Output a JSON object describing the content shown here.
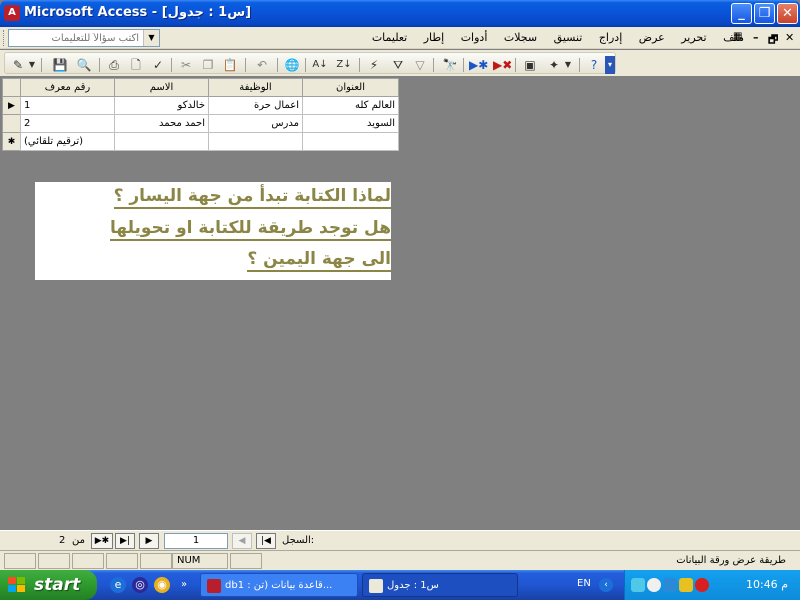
{
  "window": {
    "title": "Microsoft Access - [س1 : جدول]",
    "app_icon": "A",
    "controls": {
      "minimize": "_",
      "restore": "❐",
      "close": "✕"
    }
  },
  "help_box": {
    "placeholder": "اكتب سؤالاً للتعليمات"
  },
  "menu": {
    "items": [
      "ملف",
      "تحرير",
      "عرض",
      "إدراج",
      "تنسيق",
      "سجلات",
      "أدوات",
      "إطار",
      "تعليمات"
    ],
    "doc_controls": {
      "restore": "🗗",
      "minimize": "–",
      "close": "✕"
    }
  },
  "toolbar": {
    "icons": [
      "design-view-icon",
      "save-icon",
      "search-icon",
      "print-icon",
      "print-preview-icon",
      "spelling-icon",
      "cut-icon",
      "copy-icon",
      "paste-icon",
      "undo-icon",
      "hyperlink-icon",
      "sort-asc-icon",
      "sort-desc-icon",
      "filter-selection-icon",
      "filter-form-icon",
      "apply-filter-icon",
      "find-icon",
      "new-record-icon",
      "delete-record-icon",
      "database-window-icon",
      "new-object-icon",
      "help-icon"
    ]
  },
  "datasheet": {
    "columns": [
      "رقم معرف",
      "الاسم",
      "الوظيفة",
      "العنوان"
    ],
    "rows": [
      {
        "selector": "▶",
        "id": "1",
        "name": "خالدكو",
        "job": "اعمال حرة",
        "address": "العالم كله"
      },
      {
        "selector": "",
        "id": "2",
        "name": "احمد محمد",
        "job": "مدرس",
        "address": "السويد"
      }
    ],
    "new_row": {
      "selector": "✱",
      "id": "(ترقيم تلقائي)"
    }
  },
  "note": {
    "lines": [
      "لماذا الكتابة تبدأ من جهة اليسار ؟",
      "هل توجد طريقة للكتابة او تحويلها",
      "الى جهة اليمين ؟"
    ]
  },
  "navigation": {
    "label": "السجل:",
    "current": "1",
    "of_label": "من",
    "total": "2",
    "buttons": {
      "first": "|◀",
      "prev": "◀",
      "next": "▶",
      "last": "▶|",
      "new": "▶✱"
    }
  },
  "status": {
    "view_text": "طريقة عرض ورقة البيانات",
    "num": "NUM"
  },
  "taskbar": {
    "start": "start",
    "tasks": [
      "db1 : قاعدة بيانات (تن...",
      "س1 : جدول"
    ],
    "language": "EN",
    "clock": "10:46 م"
  },
  "colors": {
    "title_blue": "#0a52d8",
    "note_text": "#8b8645",
    "client_bg": "#808080"
  }
}
